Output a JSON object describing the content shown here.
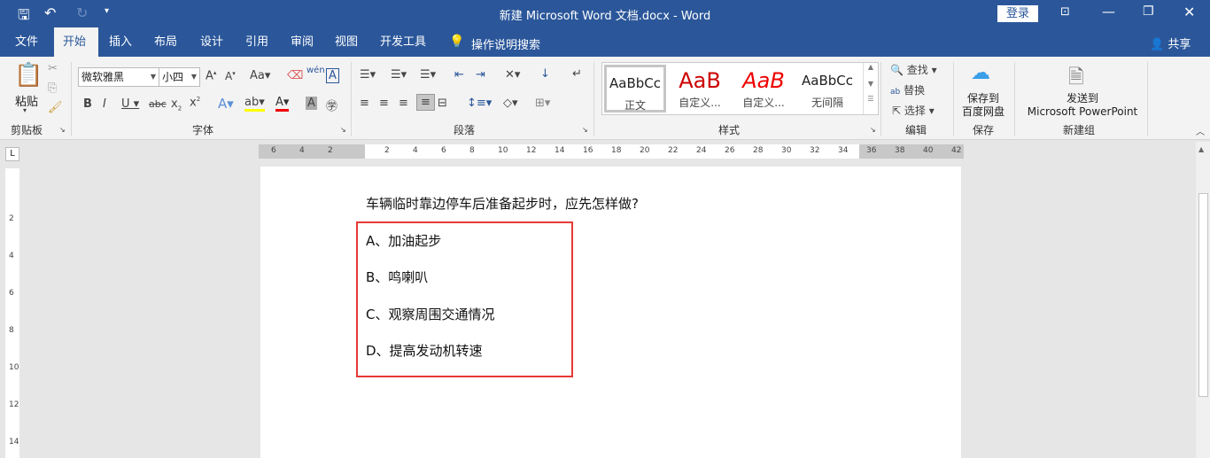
{
  "titlebar": {
    "title": "新建 Microsoft Word 文档.docx  -  Word",
    "login": "登录"
  },
  "tabs": [
    "文件",
    "开始",
    "插入",
    "布局",
    "设计",
    "引用",
    "审阅",
    "视图",
    "开发工具"
  ],
  "tell_me": "操作说明搜索",
  "share": "共享",
  "ribbon": {
    "clipboard": {
      "paste": "粘贴",
      "label": "剪贴板"
    },
    "font": {
      "name": "微软雅黑",
      "size": "小四",
      "label": "字体"
    },
    "paragraph": {
      "label": "段落"
    },
    "styles": {
      "label": "样式",
      "items": [
        {
          "preview": "AaBbCc",
          "name": "正文"
        },
        {
          "preview": "AaB",
          "name": "自定义..."
        },
        {
          "preview": "AaB",
          "name": "自定义..."
        },
        {
          "preview": "AaBbCc",
          "name": "无间隔"
        }
      ]
    },
    "editing": {
      "find": "查找",
      "replace": "替换",
      "select": "选择",
      "label": "编辑"
    },
    "save": {
      "btn": "保存到\n百度网盘",
      "line1": "保存到",
      "line2": "百度网盘",
      "label": "保存"
    },
    "newgroup": {
      "line1": "发送到",
      "line2": "Microsoft PowerPoint",
      "label": "新建组"
    }
  },
  "ruler": [
    "6",
    "4",
    "2",
    "",
    "2",
    "4",
    "6",
    "8",
    "10",
    "12",
    "14",
    "16",
    "18",
    "20",
    "22",
    "24",
    "26",
    "28",
    "30",
    "32",
    "34",
    "36",
    "38",
    "40",
    "42"
  ],
  "vruler": [
    "2",
    "4",
    "6",
    "8",
    "10",
    "12",
    "14"
  ],
  "document": {
    "question": "车辆临时靠边停车后准备起步时，应先怎样做?",
    "options": [
      "A、加油起步",
      "B、鸣喇叭",
      "C、观察周围交通情况",
      "D、提高发动机转速"
    ]
  },
  "colors": {
    "brand": "#2b579a",
    "highlight_box": "#e53935"
  }
}
